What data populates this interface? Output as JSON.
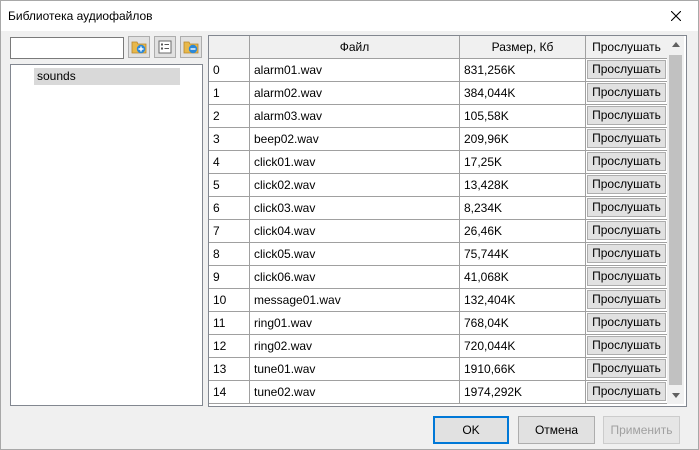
{
  "window": {
    "title": "Библиотека аудиофайлов"
  },
  "left_panel": {
    "search_value": "",
    "tree_items": [
      "sounds"
    ]
  },
  "table": {
    "headers": [
      "",
      "Файл",
      "Размер, Кб",
      "Прослушать"
    ],
    "play_label": "Прослушать",
    "rows": [
      {
        "index": "0",
        "file": "alarm01.wav",
        "size": "831,256K"
      },
      {
        "index": "1",
        "file": "alarm02.wav",
        "size": "384,044K"
      },
      {
        "index": "2",
        "file": "alarm03.wav",
        "size": "105,58K"
      },
      {
        "index": "3",
        "file": "beep02.wav",
        "size": "209,96K"
      },
      {
        "index": "4",
        "file": "click01.wav",
        "size": "17,25K"
      },
      {
        "index": "5",
        "file": "click02.wav",
        "size": "13,428K"
      },
      {
        "index": "6",
        "file": "click03.wav",
        "size": "8,234K"
      },
      {
        "index": "7",
        "file": "click04.wav",
        "size": "26,46K"
      },
      {
        "index": "8",
        "file": "click05.wav",
        "size": "75,744K"
      },
      {
        "index": "9",
        "file": "click06.wav",
        "size": "41,068K"
      },
      {
        "index": "10",
        "file": "message01.wav",
        "size": "132,404K"
      },
      {
        "index": "11",
        "file": "ring01.wav",
        "size": "768,04K"
      },
      {
        "index": "12",
        "file": "ring02.wav",
        "size": "720,044K"
      },
      {
        "index": "13",
        "file": "tune01.wav",
        "size": "1910,66K"
      },
      {
        "index": "14",
        "file": "tune02.wav",
        "size": "1974,292K"
      }
    ]
  },
  "buttons": {
    "ok": "OK",
    "cancel": "Отмена",
    "apply": "Применить"
  },
  "icons": [
    "close-icon",
    "add-folder-icon",
    "list-icon",
    "remove-folder-icon",
    "scroll-up-icon",
    "scroll-down-icon"
  ]
}
